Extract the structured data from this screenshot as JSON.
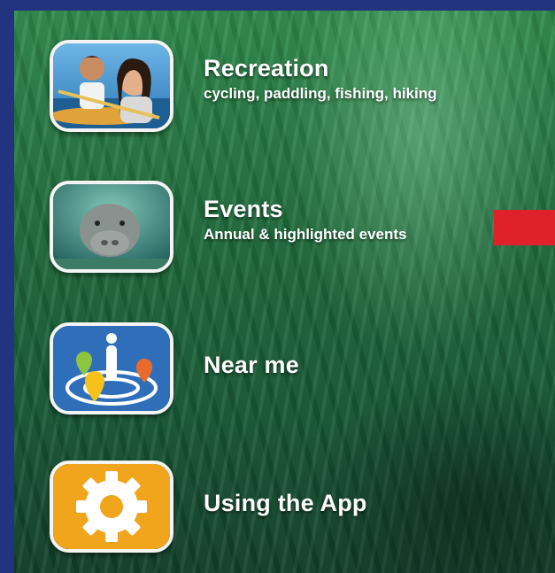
{
  "menu": {
    "items": [
      {
        "title": "Recreation",
        "subtitle": "cycling, paddling, fishing, hiking",
        "icon": "kayaking-couple-photo-icon"
      },
      {
        "title": "Events",
        "subtitle": "Annual & highlighted events",
        "icon": "manatee-photo-icon"
      },
      {
        "title": "Near me",
        "subtitle": "",
        "icon": "location-pins-icon"
      },
      {
        "title": "Using the App",
        "subtitle": "",
        "icon": "gear-icon"
      }
    ]
  },
  "colors": {
    "frame": "#22347f",
    "accent_red": "#e0202a",
    "near_me_tile": "#2f6fb9",
    "using_app_tile": "#f0a51c",
    "text": "#ffffff"
  }
}
